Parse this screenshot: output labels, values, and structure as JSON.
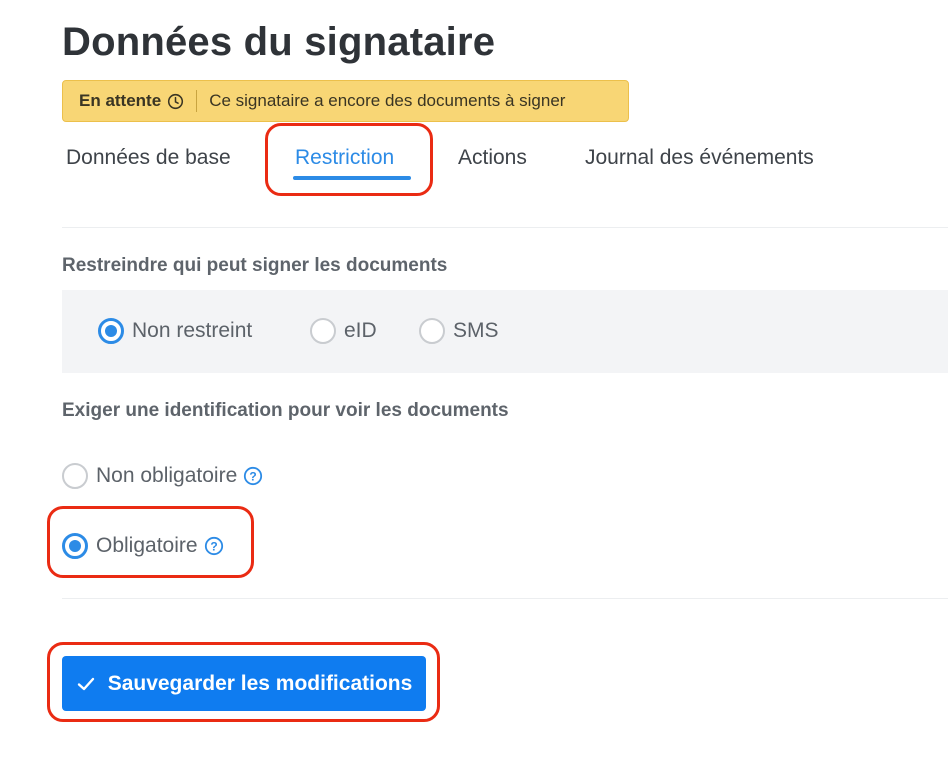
{
  "page": {
    "title": "Données du signataire"
  },
  "status": {
    "label": "En attente",
    "message": "Ce signataire a encore des documents à signer",
    "icon": "clock-icon"
  },
  "tabs": [
    {
      "label": "Données de base",
      "active": false
    },
    {
      "label": "Restriction",
      "active": true
    },
    {
      "label": "Actions",
      "active": false
    },
    {
      "label": "Journal des événements",
      "active": false
    }
  ],
  "restriction": {
    "heading": "Restreindre qui peut signer les documents",
    "options": [
      {
        "label": "Non restreint",
        "checked": true
      },
      {
        "label": "eID",
        "checked": false
      },
      {
        "label": "SMS",
        "checked": false
      }
    ]
  },
  "identification": {
    "heading": "Exiger une identification pour voir les documents",
    "options": [
      {
        "label": "Non obligatoire",
        "checked": false,
        "icon": "help-icon"
      },
      {
        "label": "Obligatoire",
        "checked": true,
        "icon": "help-icon"
      }
    ]
  },
  "actions": {
    "save_label": "Sauvegarder les modifications",
    "icon": "check-icon"
  },
  "colors": {
    "accent": "#2c8be6",
    "button": "#0f7cf0",
    "banner": "#f8d675",
    "highlight": "#ea2b13"
  }
}
